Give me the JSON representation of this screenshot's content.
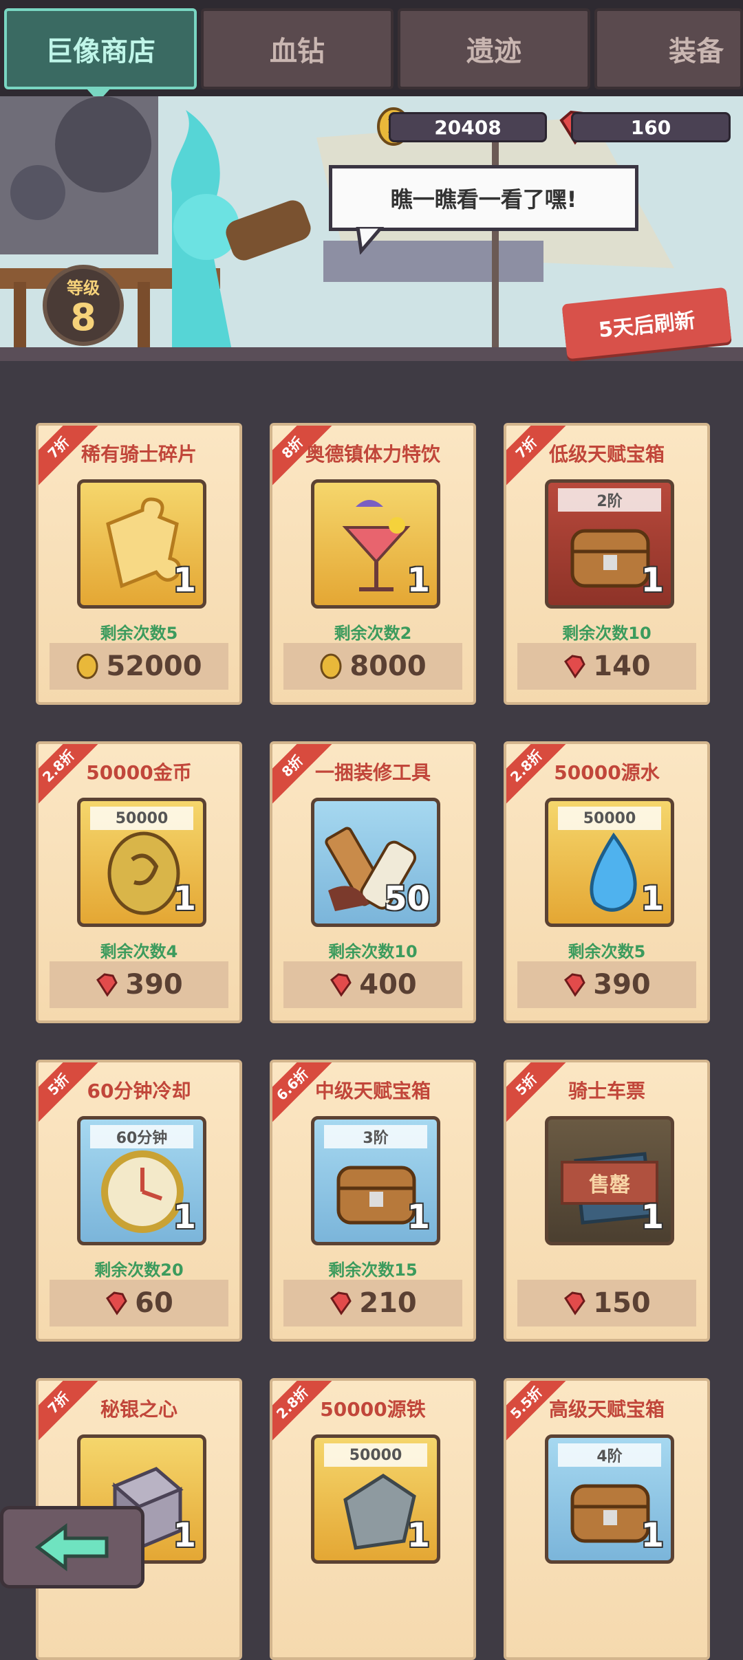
{
  "tabs": [
    {
      "label": "巨像商店",
      "active": true
    },
    {
      "label": "血钻",
      "active": false
    },
    {
      "label": "遗迹",
      "active": false
    },
    {
      "label": "装备",
      "active": false
    }
  ],
  "header": {
    "gold": "20408",
    "gems": "160",
    "speech": "瞧一瞧看一看了嘿!",
    "level_label": "等级",
    "level_value": "8",
    "refresh_text": "5天后刷新"
  },
  "items": [
    {
      "name": "稀有骑士碎片",
      "discount": "7折",
      "icon": "puzzle-piece-icon",
      "qty": "1",
      "remaining": "剩余次数5",
      "currency": "gold",
      "price": "52000"
    },
    {
      "name": "奥德镇体力特饮",
      "discount": "8折",
      "icon": "cocktail-icon",
      "qty": "1",
      "remaining": "剩余次数2",
      "currency": "gold",
      "price": "8000"
    },
    {
      "name": "低级天赋宝箱",
      "discount": "7折",
      "tag": "2阶",
      "icon": "treasure-chest-icon",
      "qty": "1",
      "remaining": "剩余次数10",
      "currency": "gem",
      "price": "140"
    },
    {
      "name": "50000金币",
      "discount": "2.8折",
      "tag": "50000",
      "icon": "gold-coin-icon",
      "qty": "1",
      "remaining": "剩余次数4",
      "currency": "gem",
      "price": "390"
    },
    {
      "name": "一捆装修工具",
      "discount": "8折",
      "icon": "repair-tools-icon",
      "qty": "50",
      "remaining": "剩余次数10",
      "currency": "gem",
      "price": "400"
    },
    {
      "name": "50000源水",
      "discount": "2.8折",
      "tag": "50000",
      "icon": "water-drop-icon",
      "qty": "1",
      "remaining": "剩余次数5",
      "currency": "gem",
      "price": "390"
    },
    {
      "name": "60分钟冷却",
      "discount": "5折",
      "tag": "60分钟",
      "icon": "clock-icon",
      "qty": "1",
      "remaining": "剩余次数20",
      "currency": "gem",
      "price": "60"
    },
    {
      "name": "中级天赋宝箱",
      "discount": "6.6折",
      "tag": "3阶",
      "icon": "treasure-chest-icon",
      "qty": "1",
      "remaining": "剩余次数15",
      "currency": "gem",
      "price": "210"
    },
    {
      "name": "骑士车票",
      "discount": "5折",
      "icon": "ticket-icon",
      "qty": "1",
      "sold": "售罄",
      "currency": "gem",
      "price": "150"
    },
    {
      "name": "秘银之心",
      "discount": "7折",
      "icon": "mithril-box-icon",
      "qty": "1"
    },
    {
      "name": "50000源铁",
      "discount": "2.8折",
      "tag": "50000",
      "icon": "iron-ore-icon",
      "qty": "1"
    },
    {
      "name": "高级天赋宝箱",
      "discount": "5.5折",
      "tag": "4阶",
      "icon": "treasure-chest-icon",
      "qty": "1"
    }
  ]
}
